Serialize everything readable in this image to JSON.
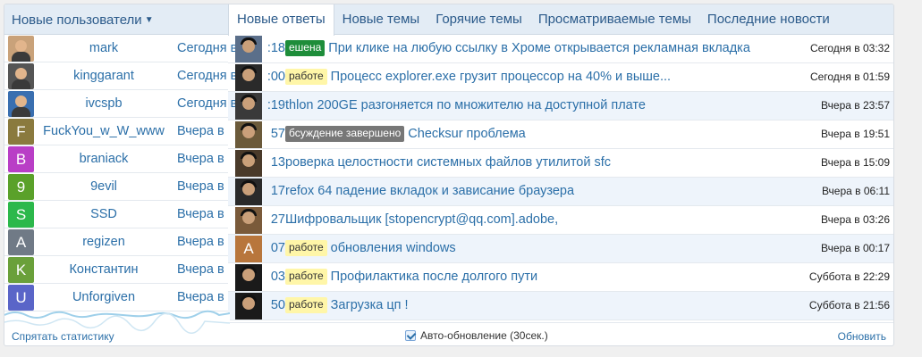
{
  "header": {
    "users_tab_label": "Новые пользователи",
    "tabs": [
      {
        "label": "Новые ответы"
      },
      {
        "label": "Новые темы"
      },
      {
        "label": "Горячие темы"
      },
      {
        "label": "Просматриваемые темы"
      },
      {
        "label": "Последние новости"
      }
    ]
  },
  "users": [
    {
      "name": "mark",
      "time": "Сегодня в ",
      "avatar": "photo",
      "color": "#c9a27a"
    },
    {
      "name": "kinggarant",
      "time": "Сегодня в ",
      "avatar": "photo",
      "color": "#555555"
    },
    {
      "name": "ivcspb",
      "time": "Сегодня в ",
      "avatar": "photo",
      "color": "#3a6fb0"
    },
    {
      "name": "FuckYou_w_W_www",
      "time": "Вчера в ",
      "avatar": "letter",
      "letter": "F",
      "color": "#8a7a3e"
    },
    {
      "name": "braniack",
      "time": "Вчера в ",
      "avatar": "letter",
      "letter": "B",
      "color": "#b93ec6"
    },
    {
      "name": "9evil",
      "time": "Вчера в ",
      "avatar": "letter",
      "letter": "9",
      "color": "#5aa12a"
    },
    {
      "name": "SSD",
      "time": "Вчера в ",
      "avatar": "letter",
      "letter": "S",
      "color": "#2cb84b"
    },
    {
      "name": "regizen",
      "time": "Вчера в ",
      "avatar": "letter",
      "letter": "A",
      "color": "#707a86"
    },
    {
      "name": "Константин",
      "time": "Вчера в ",
      "avatar": "letter",
      "letter": "K",
      "color": "#6aa03a"
    },
    {
      "name": "Unforgiven",
      "time": "Вчера в ",
      "avatar": "letter",
      "letter": "U",
      "color": "#5a65c8"
    }
  ],
  "topics": [
    {
      "prefix": "ешена",
      "prefix_style": "green",
      "title": "При клике на любую ссылку в Хроме открывается рекламная вкладка",
      "time": "Сегодня в 03:32",
      "peek": ":18",
      "avatar": "photo",
      "color": "#5b6f8a"
    },
    {
      "prefix": "работе",
      "prefix_style": "yellow",
      "title": "Процесс explorer.exe грузит процессор на 40% и выше...",
      "time": "Сегодня в 01:59",
      "peek": ":00",
      "avatar": "photo",
      "color": "#2a2a2a"
    },
    {
      "prefix": "",
      "prefix_style": "",
      "title": "thlon 200GE разгоняется по множителю на доступной плате",
      "time": "Вчера в 23:57",
      "peek": ":19",
      "avatar": "photo",
      "color": "#3a3a3a"
    },
    {
      "prefix": "бсуждение завершено",
      "prefix_style": "gray",
      "title": "Checksur проблема",
      "time": "Вчера в 19:51",
      "peek": "57",
      "avatar": "photo",
      "color": "#6b5a3a"
    },
    {
      "prefix": "",
      "prefix_style": "",
      "title": "роверка целостности системных файлов утилитой sfc",
      "time": "Вчера в 15:09",
      "peek": "13",
      "avatar": "photo",
      "color": "#4a3a2a"
    },
    {
      "prefix": "",
      "prefix_style": "",
      "title": "refox 64 падение вкладок и зависание браузера",
      "time": "Вчера в 06:11",
      "peek": "17",
      "avatar": "photo",
      "color": "#2a2a2a"
    },
    {
      "prefix": "",
      "prefix_style": "",
      "title": "Шифровальщик [stopencrypt@qq.com].adobe,",
      "time": "Вчера в 03:26",
      "peek": "27",
      "avatar": "photo",
      "color": "#7a5a3a"
    },
    {
      "prefix": "работе",
      "prefix_style": "yellow",
      "title": "обновления windows",
      "time": "Вчера в 00:17",
      "peek": "07",
      "avatar": "letter",
      "letter": "A",
      "color": "#b8763c"
    },
    {
      "prefix": "работе",
      "prefix_style": "yellow",
      "title": "Профилактика после долгого пути",
      "time": "Суббота в 22:29",
      "peek": "03",
      "avatar": "photo",
      "color": "#1a1a1a"
    },
    {
      "prefix": "работе",
      "prefix_style": "yellow",
      "title": "Загрузка цп !",
      "time": "Суббота в 21:56",
      "peek": "50",
      "avatar": "photo",
      "color": "#1a1a1a"
    }
  ],
  "footer": {
    "hide_stats": "Спрятать статистику",
    "autoupdate": "Авто-обновление (30сек.)",
    "refresh": "Обновить"
  }
}
